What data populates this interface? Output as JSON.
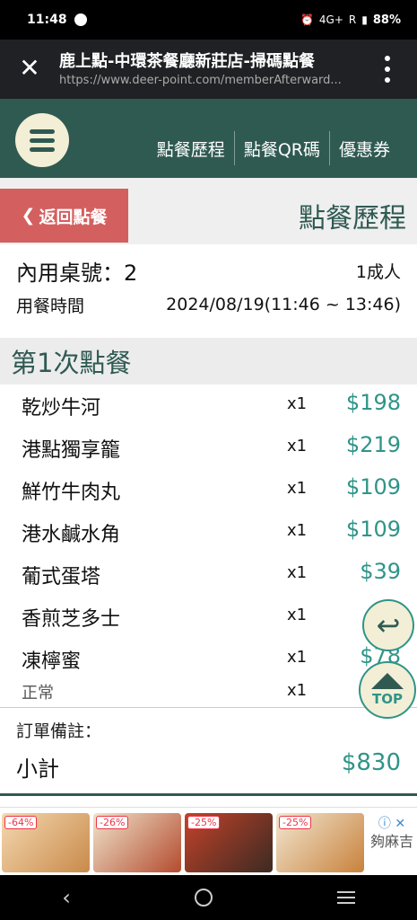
{
  "status": {
    "time": "11:48",
    "battery": "88%",
    "network": "4G+",
    "roaming": "R"
  },
  "browser": {
    "title": "鹿上點-中環茶餐廳新莊店-掃碼點餐",
    "url": "https://www.deer-point.com/memberAfterward..."
  },
  "nav": {
    "links": [
      "點餐歷程",
      "點餐QR碼",
      "優惠券"
    ]
  },
  "page": {
    "back_label": "返回點餐",
    "title": "點餐歷程"
  },
  "info": {
    "table_label": "內用桌號：2",
    "people": "1成人",
    "time_label": "用餐時間",
    "time_value": "2024/08/19(11:46 ~ 13:46)"
  },
  "order": {
    "heading": "第1次點餐",
    "items": [
      {
        "name": "乾炒牛河",
        "qty": "x1",
        "price": "$198"
      },
      {
        "name": "港點獨享籠",
        "qty": "x1",
        "price": "$219"
      },
      {
        "name": "鮮竹牛肉丸",
        "qty": "x1",
        "price": "$109"
      },
      {
        "name": "港水鹹水角",
        "qty": "x1",
        "price": "$109"
      },
      {
        "name": "葡式蛋塔",
        "qty": "x1",
        "price": "$39"
      },
      {
        "name": "香煎芝多士",
        "qty": "x1",
        "price": ""
      },
      {
        "name": "凍檸蜜",
        "qty": "x1",
        "price": "$78"
      }
    ],
    "note": "正常",
    "note_qty": "x1",
    "remark_label": "訂單備註：",
    "subtotal_label": "小計",
    "subtotal_value": "$830"
  },
  "floats": {
    "top_label": "TOP"
  },
  "ads": {
    "badges": [
      "-64%",
      "-26%",
      "-25%",
      "-25%"
    ],
    "side_text": "夠麻吉"
  },
  "colors": {
    "primary": "#2f5a52",
    "accent": "#2f9488",
    "back_btn": "#d45f5f",
    "cream": "#f3eed6"
  }
}
